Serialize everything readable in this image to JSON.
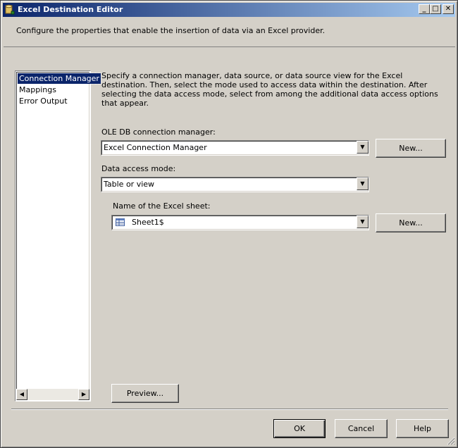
{
  "window": {
    "title": "Excel Destination Editor",
    "buttons": {
      "minimize": "_",
      "maximize": "□",
      "close": "✕"
    }
  },
  "header": {
    "text": "Configure the properties that enable the insertion of data via an Excel provider."
  },
  "nav": {
    "items": [
      {
        "label": "Connection Manager",
        "selected": true
      },
      {
        "label": "Mappings",
        "selected": false
      },
      {
        "label": "Error Output",
        "selected": false
      }
    ],
    "scroll_left": "◀",
    "scroll_right": "▶"
  },
  "main": {
    "description": "Specify a connection manager, data source, or data source view for the Excel destination. Then, select the mode used to access data within the destination. After selecting the data access mode, select from among the additional data access options that appear.",
    "connection_label": "OLE DB connection manager:",
    "connection_value": "Excel Connection Manager",
    "connection_new": "New...",
    "access_mode_label": "Data access mode:",
    "access_mode_value": "Table or view",
    "sheet_label": "Name of the Excel sheet:",
    "sheet_value": "Sheet1$",
    "sheet_new": "New...",
    "preview": "Preview..."
  },
  "footer": {
    "ok": "OK",
    "cancel": "Cancel",
    "help": "Help"
  },
  "icons": {
    "dropdown": "▼"
  }
}
